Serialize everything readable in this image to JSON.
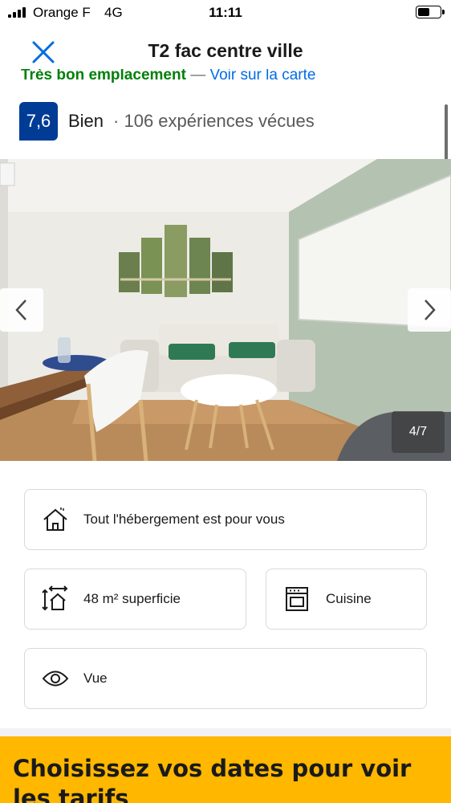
{
  "status_bar": {
    "carrier": "Orange F",
    "network": "4G",
    "time": "11:11"
  },
  "header": {
    "title": "T2 fac centre ville",
    "close_icon": "close-icon"
  },
  "location": {
    "label": "Très bon emplacement",
    "separator": "—",
    "map_link": "Voir sur la carte"
  },
  "rating": {
    "score": "7,6",
    "word": "Bien",
    "reviews": "· 106 expériences vécues"
  },
  "gallery": {
    "counter": "4/7",
    "prev_icon": "chevron-left-icon",
    "next_icon": "chevron-right-icon"
  },
  "features": [
    {
      "icon": "house-icon",
      "label": "Tout l'hébergement est pour vous"
    },
    {
      "icon": "room-size-icon",
      "label": "48 m² superficie"
    },
    {
      "icon": "oven-icon",
      "label": "Cuisine"
    },
    {
      "icon": "eye-icon",
      "label": "Vue"
    }
  ],
  "dates_banner": {
    "text": "Choisissez vos dates pour voir les tarifs"
  },
  "colors": {
    "brand_blue": "#003b95",
    "link_blue": "#006ce4",
    "location_green": "#008009",
    "banner_yellow": "#ffb700"
  }
}
